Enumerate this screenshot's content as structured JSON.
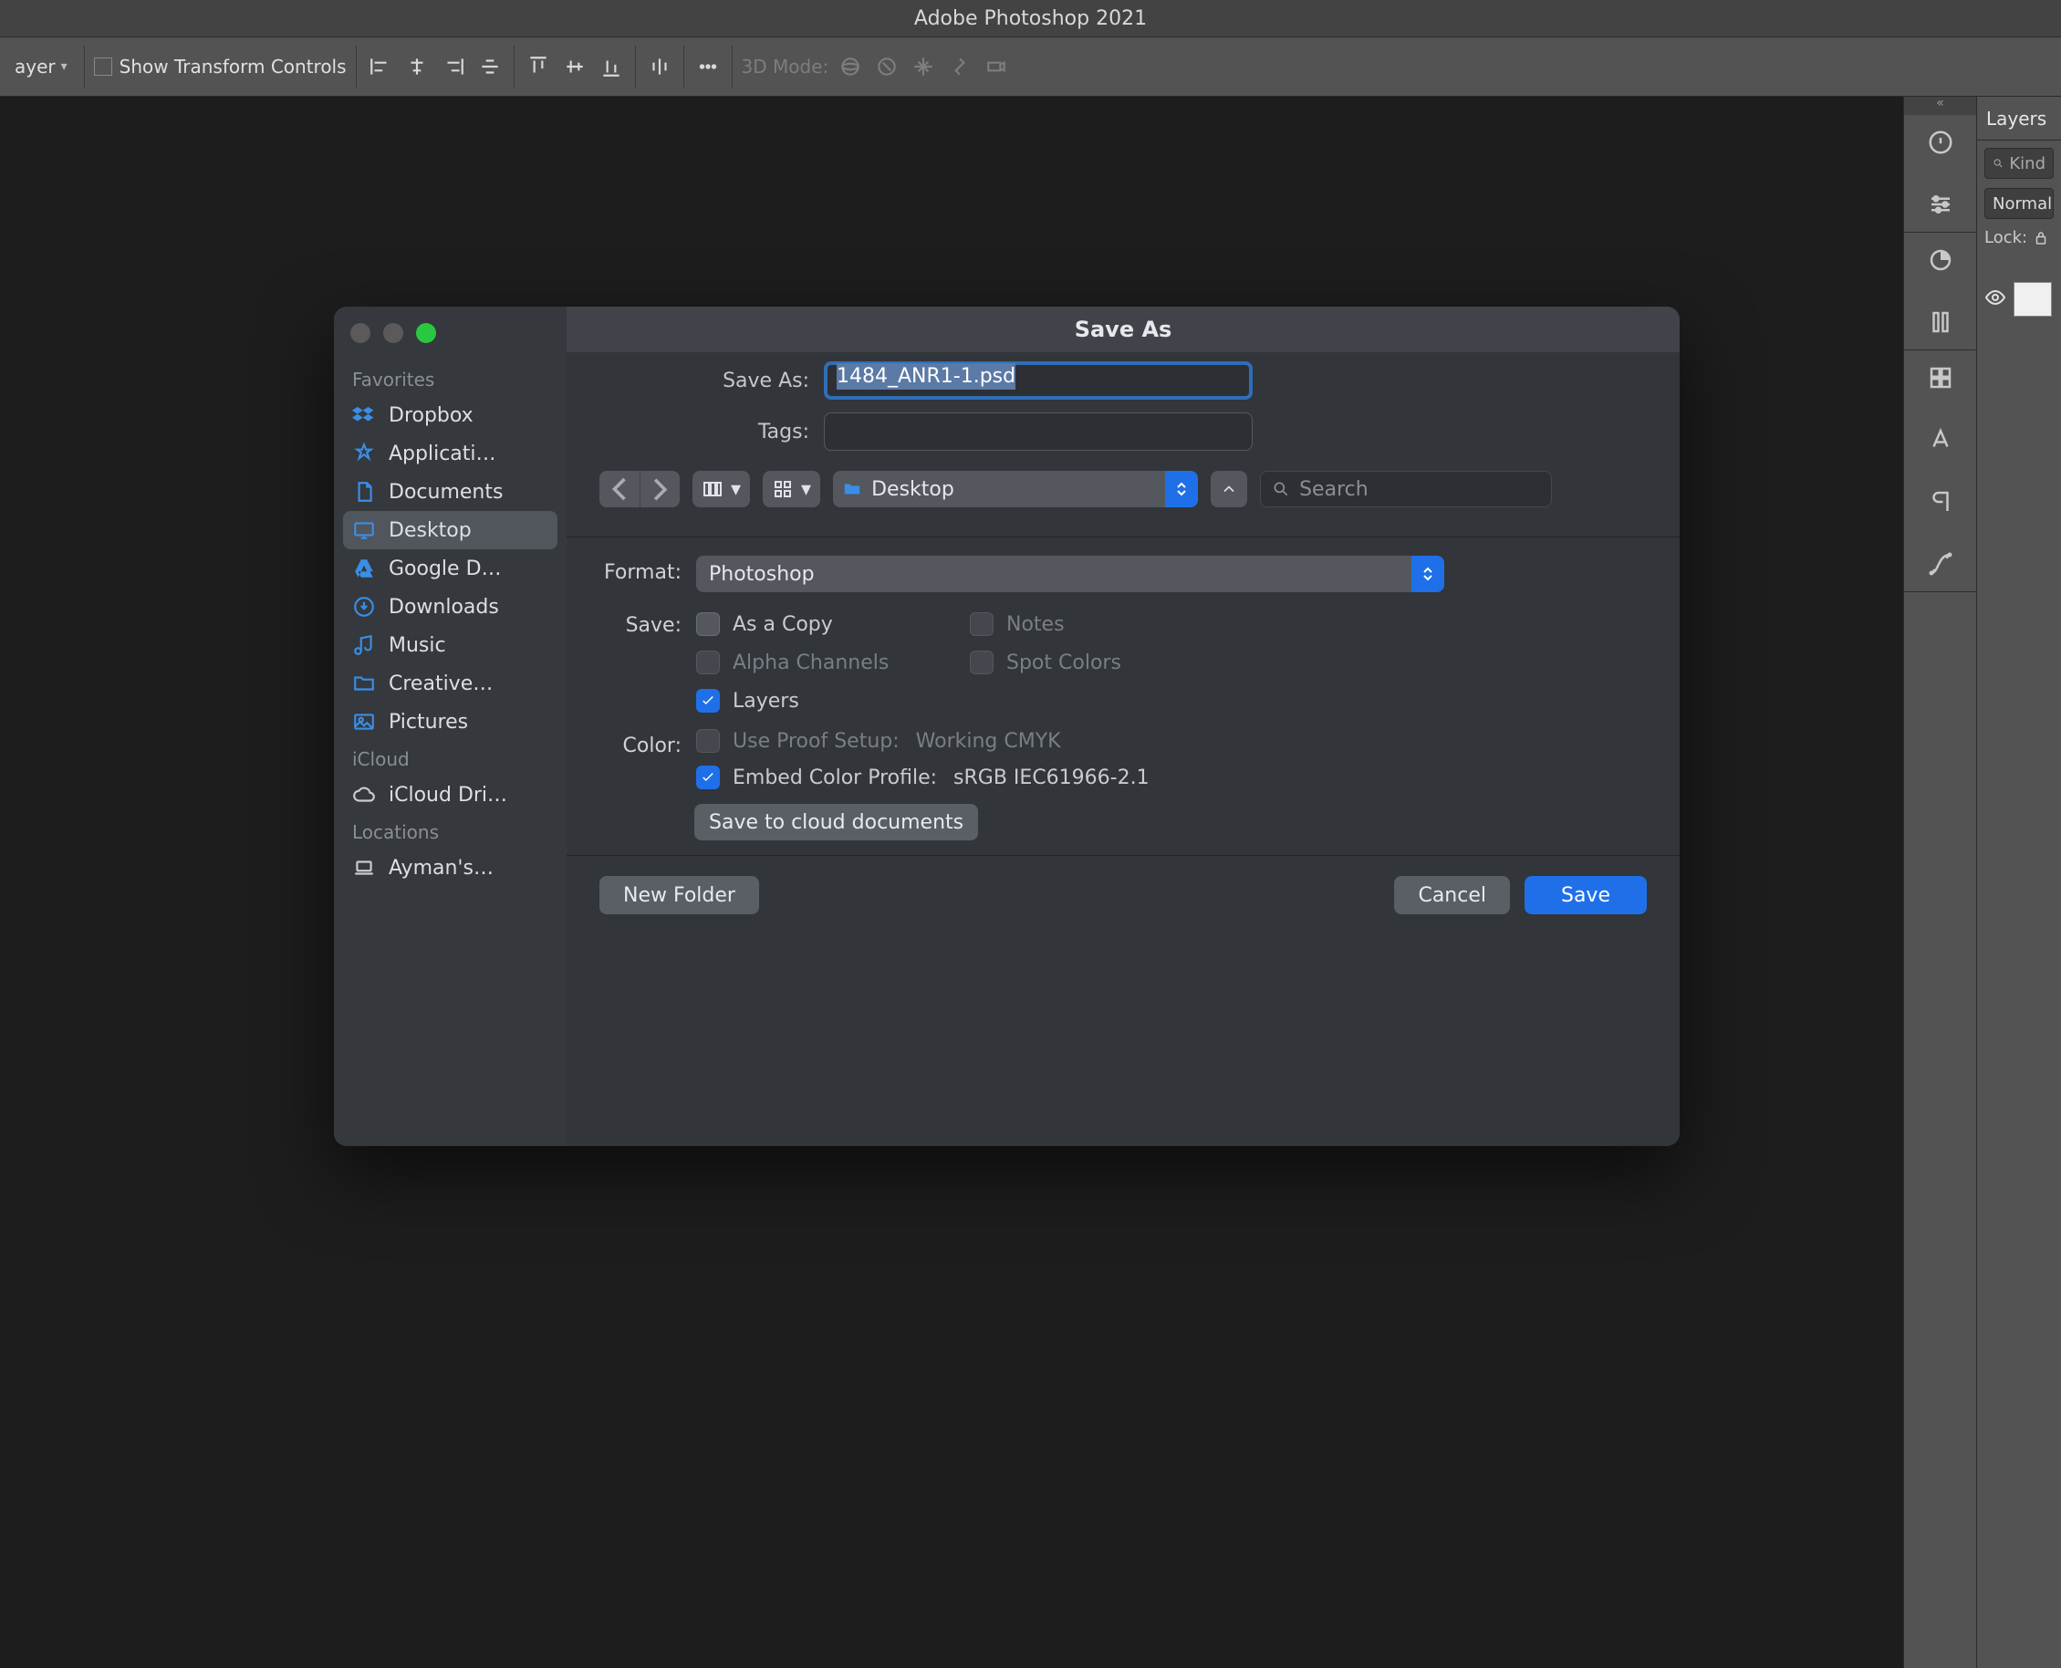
{
  "app": {
    "title": "Adobe Photoshop 2021"
  },
  "optionsbar": {
    "layer_select": "ayer",
    "show_transform": "Show Transform Controls",
    "mode3d": "3D Mode:"
  },
  "layers_panel": {
    "tab": "Layers",
    "filter_placeholder": "Kind",
    "blend_mode": "Normal",
    "lock_label": "Lock:"
  },
  "dialog": {
    "title": "Save As",
    "save_as_label": "Save As:",
    "filename": "1484_ANR1-1.psd",
    "tags_label": "Tags:",
    "tags_value": "",
    "search_placeholder": "Search",
    "location": "Desktop",
    "format_label": "Format:",
    "format_value": "Photoshop",
    "save_label": "Save:",
    "color_label": "Color:",
    "checks": {
      "as_a_copy": "As a Copy",
      "notes": "Notes",
      "alpha_channels": "Alpha Channels",
      "spot_colors": "Spot Colors",
      "layers": "Layers",
      "use_proof": "Use Proof Setup:",
      "working_cmyk": "Working CMYK",
      "embed_profile": "Embed Color Profile:",
      "profile_name": "sRGB IEC61966-2.1"
    },
    "cloud_btn": "Save to cloud documents",
    "new_folder": "New Folder",
    "cancel": "Cancel",
    "save": "Save",
    "sidebar": {
      "favorites_label": "Favorites",
      "icloud_label": "iCloud",
      "locations_label": "Locations",
      "items": {
        "dropbox": "Dropbox",
        "applications": "Applicati…",
        "documents": "Documents",
        "desktop": "Desktop",
        "google_drive": "Google D…",
        "downloads": "Downloads",
        "music": "Music",
        "creative": "Creative…",
        "pictures": "Pictures",
        "icloud_drive": "iCloud Dri…",
        "ayman_mac": "Ayman's…"
      }
    }
  }
}
